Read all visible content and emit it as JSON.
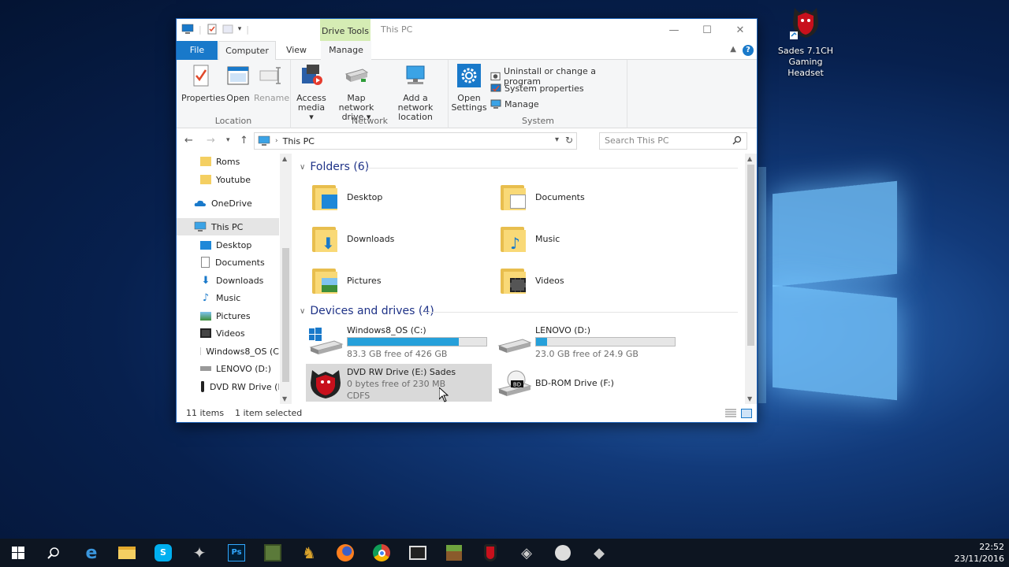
{
  "desktop": {
    "icon_label": "Sades 7.1CH\nGaming\nHeadset",
    "icon_name": "sades-headset-icon"
  },
  "window": {
    "title": "This PC",
    "context_tab": "Drive Tools",
    "tabs": {
      "file": "File",
      "computer": "Computer",
      "view": "View",
      "manage": "Manage"
    },
    "help": "?"
  },
  "ribbon": {
    "location": {
      "group_label": "Location",
      "properties": "Properties",
      "open": "Open",
      "rename": "Rename"
    },
    "network": {
      "group_label": "Network",
      "access_media_1": "Access",
      "access_media_2": "media ▾",
      "map_drive_1": "Map network",
      "map_drive_2": "drive ▾",
      "add_location_1": "Add a network",
      "add_location_2": "location"
    },
    "system": {
      "group_label": "System",
      "open_settings_1": "Open",
      "open_settings_2": "Settings",
      "uninstall": "Uninstall or change a program",
      "system_properties": "System properties",
      "manage": "Manage"
    }
  },
  "address": {
    "path": "This PC",
    "search_placeholder": "Search This PC"
  },
  "nav_pane": {
    "items": [
      {
        "label": "Roms",
        "icon": "folder-icon"
      },
      {
        "label": "Youtube",
        "icon": "folder-icon"
      },
      {
        "label": "OneDrive",
        "icon": "onedrive-icon"
      },
      {
        "label": "This PC",
        "icon": "computer-icon"
      },
      {
        "label": "Desktop",
        "icon": "desktop-icon"
      },
      {
        "label": "Documents",
        "icon": "documents-icon"
      },
      {
        "label": "Downloads",
        "icon": "downloads-icon"
      },
      {
        "label": "Music",
        "icon": "music-icon"
      },
      {
        "label": "Pictures",
        "icon": "pictures-icon"
      },
      {
        "label": "Videos",
        "icon": "videos-icon"
      },
      {
        "label": "Windows8_OS (C",
        "icon": "windows-drive-icon"
      },
      {
        "label": "LENOVO (D:)",
        "icon": "drive-icon"
      },
      {
        "label": "DVD RW Drive (E",
        "icon": "dvd-drive-icon"
      }
    ]
  },
  "folders": {
    "header": "Folders (6)",
    "items": [
      {
        "label": "Desktop",
        "icon": "desktop-folder-icon"
      },
      {
        "label": "Documents",
        "icon": "documents-folder-icon"
      },
      {
        "label": "Downloads",
        "icon": "downloads-folder-icon"
      },
      {
        "label": "Music",
        "icon": "music-folder-icon"
      },
      {
        "label": "Pictures",
        "icon": "pictures-folder-icon"
      },
      {
        "label": "Videos",
        "icon": "videos-folder-icon"
      }
    ]
  },
  "drives": {
    "header": "Devices and drives (4)",
    "items": [
      {
        "name": "Windows8_OS (C:)",
        "free": "83.3 GB free of 426 GB",
        "used_fraction": 0.8
      },
      {
        "name": "LENOVO (D:)",
        "free": "23.0 GB free of 24.9 GB",
        "used_fraction": 0.08
      },
      {
        "name": "DVD RW Drive (E:) Sades",
        "free": "0 bytes free of 230 MB",
        "fs": "CDFS"
      },
      {
        "name": "BD-ROM Drive (F:)"
      }
    ]
  },
  "status": {
    "count": "11 items",
    "selected": "1 item selected"
  },
  "taskbar": {
    "time": "22:52",
    "date": "23/11/2016",
    "icons": [
      "start-icon",
      "search-icon",
      "edge-icon",
      "file-explorer-icon",
      "skype-icon",
      "app-icon",
      "photoshop-icon",
      "minecraft-icon",
      "game-icon",
      "firefox-icon",
      "chrome-icon",
      "app-window-icon",
      "minecraft-block-icon",
      "sades-icon",
      "app-icon-2",
      "app-icon-3",
      "app-icon-4"
    ]
  },
  "colors": {
    "accent": "#1979ca",
    "drive_bar": "#26a0da",
    "context_tab": "#d5ecb4",
    "section_header": "#1e3287"
  }
}
